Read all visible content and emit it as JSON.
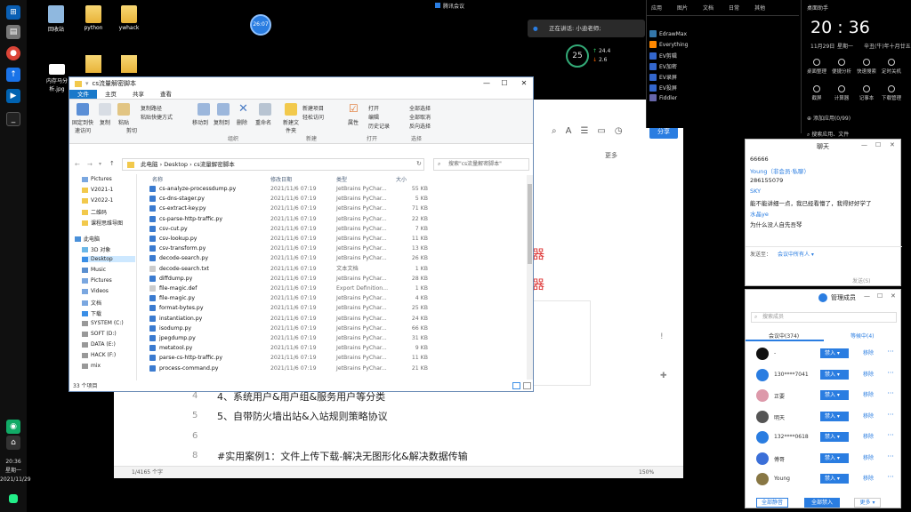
{
  "meeting": {
    "name": "腾讯会议"
  },
  "desktop": {
    "icons": [
      {
        "label": "回收站"
      },
      {
        "label": "python"
      },
      {
        "label": "ywhack"
      },
      {
        "label": "内存马分析.jpg"
      }
    ],
    "timer": "26:07"
  },
  "speaking": {
    "text": "正在讲话: 小迪老师;"
  },
  "weather": {
    "temp": "25",
    "up": "24.4",
    "down": "2.6"
  },
  "taskbar": {
    "time": "20:36",
    "weekday": "星期一",
    "date": "2021/11/29"
  },
  "apps_panel": {
    "title": "应用",
    "tabs": [
      "图片",
      "文档",
      "日常",
      "其他"
    ],
    "items": [
      "EdrawMax",
      "Everything",
      "EV剪辑",
      "EV加密",
      "EV录屏",
      "EV投屏",
      "Fiddler"
    ]
  },
  "clock_panel": {
    "title": "桌面助手",
    "time": "20 : 36",
    "date": "11月29日",
    "weekday": "星期一",
    "lunar": "辛丑(牛)年十月廿五",
    "quick": [
      "桌面整理",
      "便捷分析",
      "快速搜索",
      "定时关机",
      "截屏",
      "计算器",
      "记事本",
      "下载管理"
    ],
    "add_label": "添加应用(0/99)",
    "search_label": "搜索应用、文件"
  },
  "explorer": {
    "title": "cs流量解密脚本",
    "tabs": [
      "文件",
      "主页",
      "共享",
      "查看"
    ],
    "ribbon": {
      "pin": "固定到快速访问",
      "copy": "复制",
      "paste": "粘贴",
      "copy_path": "复制路径",
      "paste_shortcut": "粘贴快捷方式",
      "cut": "剪切",
      "move_to": "移动到",
      "copy_to": "复制到",
      "delete": "删除",
      "rename": "重命名",
      "new_folder": "新建文件夹",
      "new_item": "新建项目",
      "easy_access": "轻松访问",
      "properties": "属性",
      "open": "打开",
      "edit": "编辑",
      "history": "历史记录",
      "select_all": "全部选择",
      "select_none": "全部取消",
      "invert": "反向选择",
      "group_org": "组织",
      "group_new": "新建",
      "group_open": "打开",
      "group_select": "选择"
    },
    "address": [
      "此电脑",
      "Desktop",
      "cs流量解密脚本"
    ],
    "search_placeholder": "搜索\"cs流量解密脚本\"",
    "nav": [
      "Pictures",
      "V2021-1",
      "V2022-1",
      "二维码",
      "课程思维导图",
      "此电脑",
      "3D 对象",
      "Desktop",
      "Music",
      "Pictures",
      "Videos",
      "文档",
      "下载",
      "SYSTEM (C:)",
      "SOFT (D:)",
      "DATA (E:)",
      "HACK (F:)",
      "mix"
    ],
    "columns": {
      "name": "名称",
      "date": "修改日期",
      "type": "类型",
      "size": "大小"
    },
    "files": [
      {
        "name": "cs-analyze-processdump.py",
        "date": "2021/11/6 07:19",
        "type": "JetBrains PyChar...",
        "size": "55 KB"
      },
      {
        "name": "cs-dns-stager.py",
        "date": "2021/11/6 07:19",
        "type": "JetBrains PyChar...",
        "size": "5 KB"
      },
      {
        "name": "cs-extract-key.py",
        "date": "2021/11/6 07:19",
        "type": "JetBrains PyChar...",
        "size": "71 KB"
      },
      {
        "name": "cs-parse-http-traffic.py",
        "date": "2021/11/6 07:19",
        "type": "JetBrains PyChar...",
        "size": "22 KB"
      },
      {
        "name": "csv-cut.py",
        "date": "2021/11/6 07:19",
        "type": "JetBrains PyChar...",
        "size": "7 KB"
      },
      {
        "name": "csv-lookup.py",
        "date": "2021/11/6 07:19",
        "type": "JetBrains PyChar...",
        "size": "11 KB"
      },
      {
        "name": "csv-transform.py",
        "date": "2021/11/6 07:19",
        "type": "JetBrains PyChar...",
        "size": "13 KB"
      },
      {
        "name": "decode-search.py",
        "date": "2021/11/6 07:19",
        "type": "JetBrains PyChar...",
        "size": "26 KB"
      },
      {
        "name": "decode-search.txt",
        "date": "2021/11/6 07:19",
        "type": "文本文档",
        "size": "1 KB"
      },
      {
        "name": "diffdump.py",
        "date": "2021/11/6 07:19",
        "type": "JetBrains PyChar...",
        "size": "28 KB"
      },
      {
        "name": "file-magic.def",
        "date": "2021/11/6 07:19",
        "type": "Export Definition...",
        "size": "1 KB"
      },
      {
        "name": "file-magic.py",
        "date": "2021/11/6 07:19",
        "type": "JetBrains PyChar...",
        "size": "4 KB"
      },
      {
        "name": "format-bytes.py",
        "date": "2021/11/6 07:19",
        "type": "JetBrains PyChar...",
        "size": "25 KB"
      },
      {
        "name": "instantiation.py",
        "date": "2021/11/6 07:19",
        "type": "JetBrains PyChar...",
        "size": "24 KB"
      },
      {
        "name": "isodump.py",
        "date": "2021/11/6 07:19",
        "type": "JetBrains PyChar...",
        "size": "66 KB"
      },
      {
        "name": "jpegdump.py",
        "date": "2021/11/6 07:19",
        "type": "JetBrains PyChar...",
        "size": "31 KB"
      },
      {
        "name": "metatool.py",
        "date": "2021/11/6 07:19",
        "type": "JetBrains PyChar...",
        "size": "9 KB"
      },
      {
        "name": "parse-cs-http-traffic.py",
        "date": "2021/11/6 07:19",
        "type": "JetBrains PyChar...",
        "size": "11 KB"
      },
      {
        "name": "process-command.py",
        "date": "2021/11/6 07:19",
        "type": "JetBrains PyChar...",
        "size": "21 KB"
      }
    ],
    "status": "33 个项目"
  },
  "editor": {
    "share": "分享",
    "more": "更多",
    "lines": [
      {
        "num": "4",
        "text": "4、系统用户&用户组&服务用户等分类"
      },
      {
        "num": "5",
        "text": "5、自带防火墙出站&入站规则策略协议"
      },
      {
        "num": "6",
        "text": ""
      },
      {
        "num": "8",
        "text": "#实用案例1：文件上传下载-解决无图形化&解决数据传输"
      }
    ],
    "fragments": [
      "器",
      "器"
    ],
    "status_left": "1/4165 个字",
    "zoom": "150%"
  },
  "chat": {
    "title": "聊天",
    "messages": [
      {
        "text": "66666",
        "color": "#222"
      },
      {
        "text": "Young（非会员·私聊）",
        "color": "#2a7de1"
      },
      {
        "text": "286155079",
        "color": "#222"
      },
      {
        "text": "SKY",
        "color": "#2a7de1"
      },
      {
        "text": "能不能讲细一点，我已经看懵了，我得好好学了",
        "color": "#222"
      },
      {
        "text": "水晶ye",
        "color": "#2a7de1"
      },
      {
        "text": "为什么没人自先吾琴",
        "color": "#222"
      }
    ],
    "send_to_label": "发送至：",
    "send_to": "会议中所有人 ▾",
    "send": "发送(S)"
  },
  "members": {
    "title": "管理成员",
    "search_placeholder": "搜索成员",
    "tab_in": "会议中(374)",
    "tab_wait": "等候中(4)",
    "list": [
      {
        "name": "-",
        "color": "#111",
        "btn": "禁入"
      },
      {
        "name": "130****7041",
        "color": "#2a7de1",
        "btn": "禁入"
      },
      {
        "name": "正要",
        "color": "#d9a",
        "btn": "禁入"
      },
      {
        "name": "明天",
        "color": "#555",
        "btn": "禁入"
      },
      {
        "name": "132****0618",
        "color": "#2a7de1",
        "btn": "禁入"
      },
      {
        "name": "傅哥",
        "color": "#3b6fd8",
        "btn": "禁入"
      },
      {
        "name": "Young",
        "color": "#874",
        "btn": "禁入"
      }
    ],
    "remove_label": "移除",
    "mute_all": "全部静音",
    "unmute_all": "全部禁入",
    "more": "更多 ▾"
  }
}
